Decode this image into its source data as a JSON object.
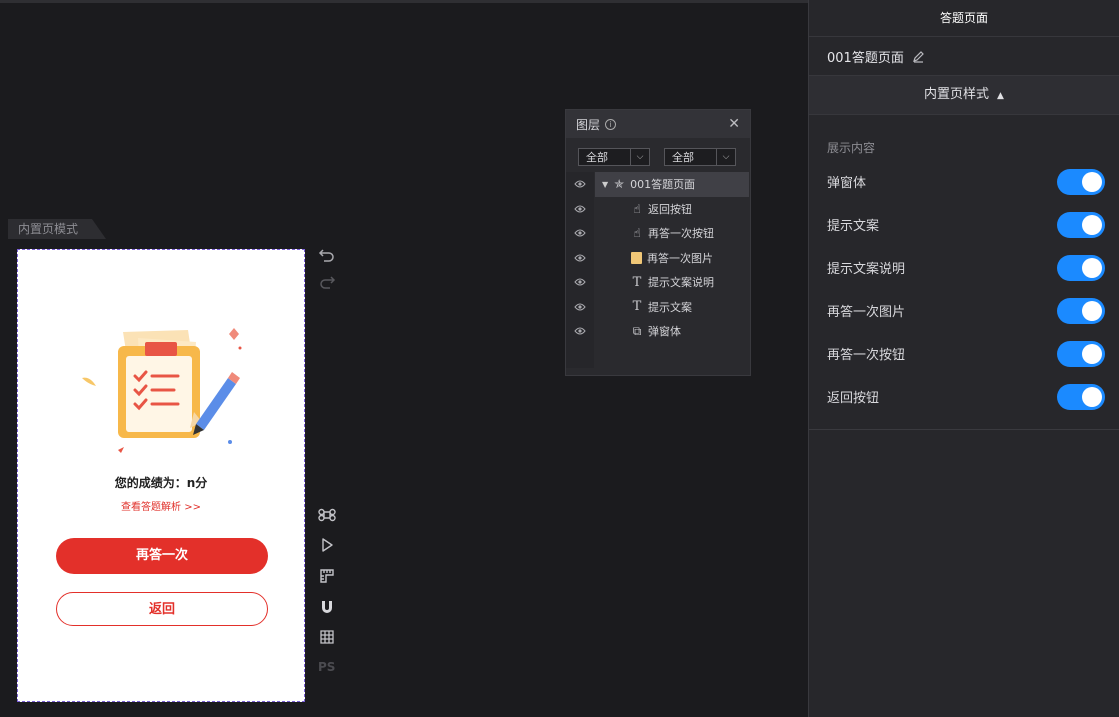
{
  "mode_tab": "内置页模式",
  "preview": {
    "score_text": "您的成绩为：n分",
    "review_link": "查看答题解析 >>",
    "retry_button": "再答一次",
    "back_button": "返回"
  },
  "tools": [
    "undo-icon",
    "redo-icon",
    "command-icon",
    "play-icon",
    "ruler-icon",
    "magnet-icon",
    "grid-icon",
    "ps-icon"
  ],
  "tools_ps_label": "PS",
  "layers": {
    "title": "图层",
    "info_icon": "i",
    "close_icon": "✕",
    "filter1": "全部",
    "filter2": "全部",
    "items": [
      {
        "label": "001答题页面",
        "icon": "component-icon",
        "level": 0,
        "selected": true
      },
      {
        "label": "返回按钮",
        "icon": "pointer-icon",
        "level": 1
      },
      {
        "label": "再答一次按钮",
        "icon": "pointer-icon",
        "level": 1
      },
      {
        "label": "再答一次图片",
        "icon": "image-icon",
        "level": 1
      },
      {
        "label": "提示文案说明",
        "icon": "text-icon",
        "level": 1
      },
      {
        "label": "提示文案",
        "icon": "text-icon",
        "level": 1
      },
      {
        "label": "弹窗体",
        "icon": "popup-icon",
        "level": 1
      }
    ]
  },
  "right_panel": {
    "title": "答题页面",
    "page_name": "001答题页面",
    "section_label": "内置页样式",
    "sub_label": "展示内容",
    "toggles": [
      {
        "label": "弹窗体",
        "on": true
      },
      {
        "label": "提示文案",
        "on": true
      },
      {
        "label": "提示文案说明",
        "on": true
      },
      {
        "label": "再答一次图片",
        "on": true
      },
      {
        "label": "再答一次按钮",
        "on": true
      },
      {
        "label": "返回按钮",
        "on": true
      }
    ]
  },
  "colors": {
    "accent_red": "#e3302a",
    "toggle_blue": "#1b8aff",
    "selection_border": "#7d62d8"
  }
}
